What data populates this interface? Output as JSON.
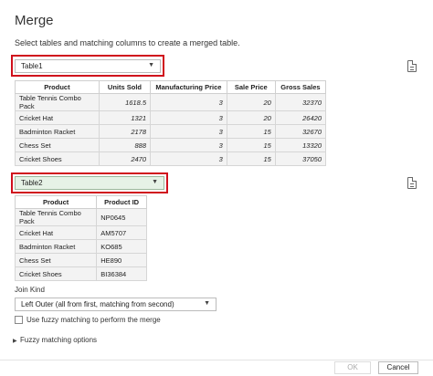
{
  "dialog": {
    "title": "Merge",
    "subtitle": "Select tables and matching columns to create a merged table."
  },
  "table1": {
    "select_value": "Table1",
    "headers": [
      "Product",
      "Units Sold",
      "Manufacturing Price",
      "Sale Price",
      "Gross Sales"
    ],
    "rows": [
      [
        "Table Tennis Combo Pack",
        "1618.5",
        "3",
        "20",
        "32370"
      ],
      [
        "Cricket Hat",
        "1321",
        "3",
        "20",
        "26420"
      ],
      [
        "Badminton Racket",
        "2178",
        "3",
        "15",
        "32670"
      ],
      [
        "Chess Set",
        "888",
        "3",
        "15",
        "13320"
      ],
      [
        "Cricket Shoes",
        "2470",
        "3",
        "15",
        "37050"
      ]
    ]
  },
  "table2": {
    "select_value": "Table2",
    "headers": [
      "Product",
      "Product ID"
    ],
    "rows": [
      [
        "Table Tennis Combo Pack",
        "NP0645"
      ],
      [
        "Cricket Hat",
        "AM5707"
      ],
      [
        "Badminton Racket",
        "KO685"
      ],
      [
        "Chess Set",
        "HE890"
      ],
      [
        "Cricket Shoes",
        "BI36384"
      ]
    ]
  },
  "join": {
    "label": "Join Kind",
    "value": "Left Outer (all from first, matching from second)",
    "fuzzy_checkbox_label": "Use fuzzy matching to perform the merge",
    "fuzzy_options_label": "Fuzzy matching options"
  },
  "footer": {
    "ok_label": "OK",
    "cancel_label": "Cancel"
  },
  "colors": {
    "highlight_border": "#d0101c",
    "selected_select_bg": "#e6f2e6"
  },
  "icons": {
    "file_preview": "file-preview-icon",
    "dropdown": "chevron-down-icon",
    "expand": "triangle-right-icon"
  }
}
